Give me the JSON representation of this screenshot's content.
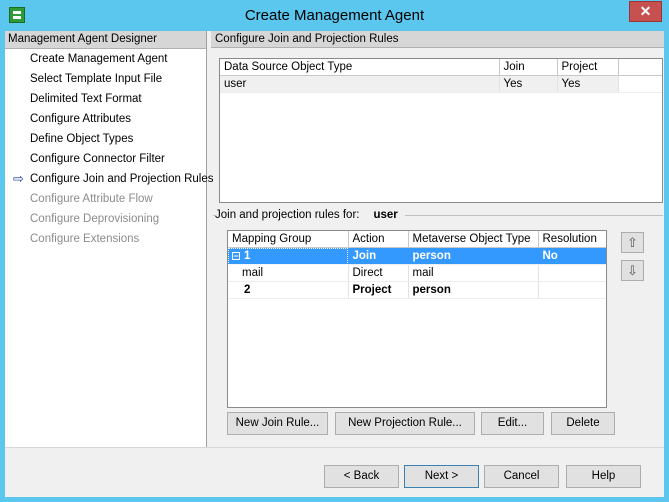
{
  "window": {
    "title": "Create Management Agent",
    "close_label": "✕"
  },
  "sidebar": {
    "header": "Management Agent Designer",
    "steps": [
      {
        "label": "Create Management Agent"
      },
      {
        "label": "Select Template Input File"
      },
      {
        "label": "Delimited Text Format"
      },
      {
        "label": "Configure Attributes"
      },
      {
        "label": "Define Object Types"
      },
      {
        "label": "Configure Connector Filter"
      },
      {
        "label": "Configure Join and Projection Rules"
      },
      {
        "label": "Configure Attribute Flow"
      },
      {
        "label": "Configure Deprovisioning"
      },
      {
        "label": "Configure Extensions"
      }
    ],
    "current_arrow": "⇨"
  },
  "main": {
    "header": "Configure Join and Projection Rules",
    "ds_table": {
      "columns": [
        "Data Source Object Type",
        "Join",
        "Project"
      ],
      "rows": [
        {
          "type": "user",
          "join": "Yes",
          "project": "Yes"
        }
      ]
    },
    "rules": {
      "label": "Join and projection rules for:",
      "object": "user",
      "columns": [
        "Mapping Group",
        "Action",
        "Metaverse Object Type",
        "Resolution"
      ],
      "rows": [
        {
          "expander": "−",
          "group": "1",
          "action": "Join",
          "mv_type": "person",
          "resolution": "No"
        },
        {
          "expander": "",
          "group": "mail",
          "action": "Direct",
          "mv_type": "mail",
          "resolution": ""
        },
        {
          "expander": "",
          "group": "2",
          "action": "Project",
          "mv_type": "person",
          "resolution": ""
        }
      ]
    },
    "buttons": {
      "new_join": "New Join Rule...",
      "new_projection": "New Projection Rule...",
      "edit": "Edit...",
      "delete": "Delete",
      "move_up": "⇧",
      "move_down": "⇩"
    }
  },
  "footer": {
    "back": "< Back",
    "next": "Next >",
    "cancel": "Cancel",
    "help": "Help"
  }
}
